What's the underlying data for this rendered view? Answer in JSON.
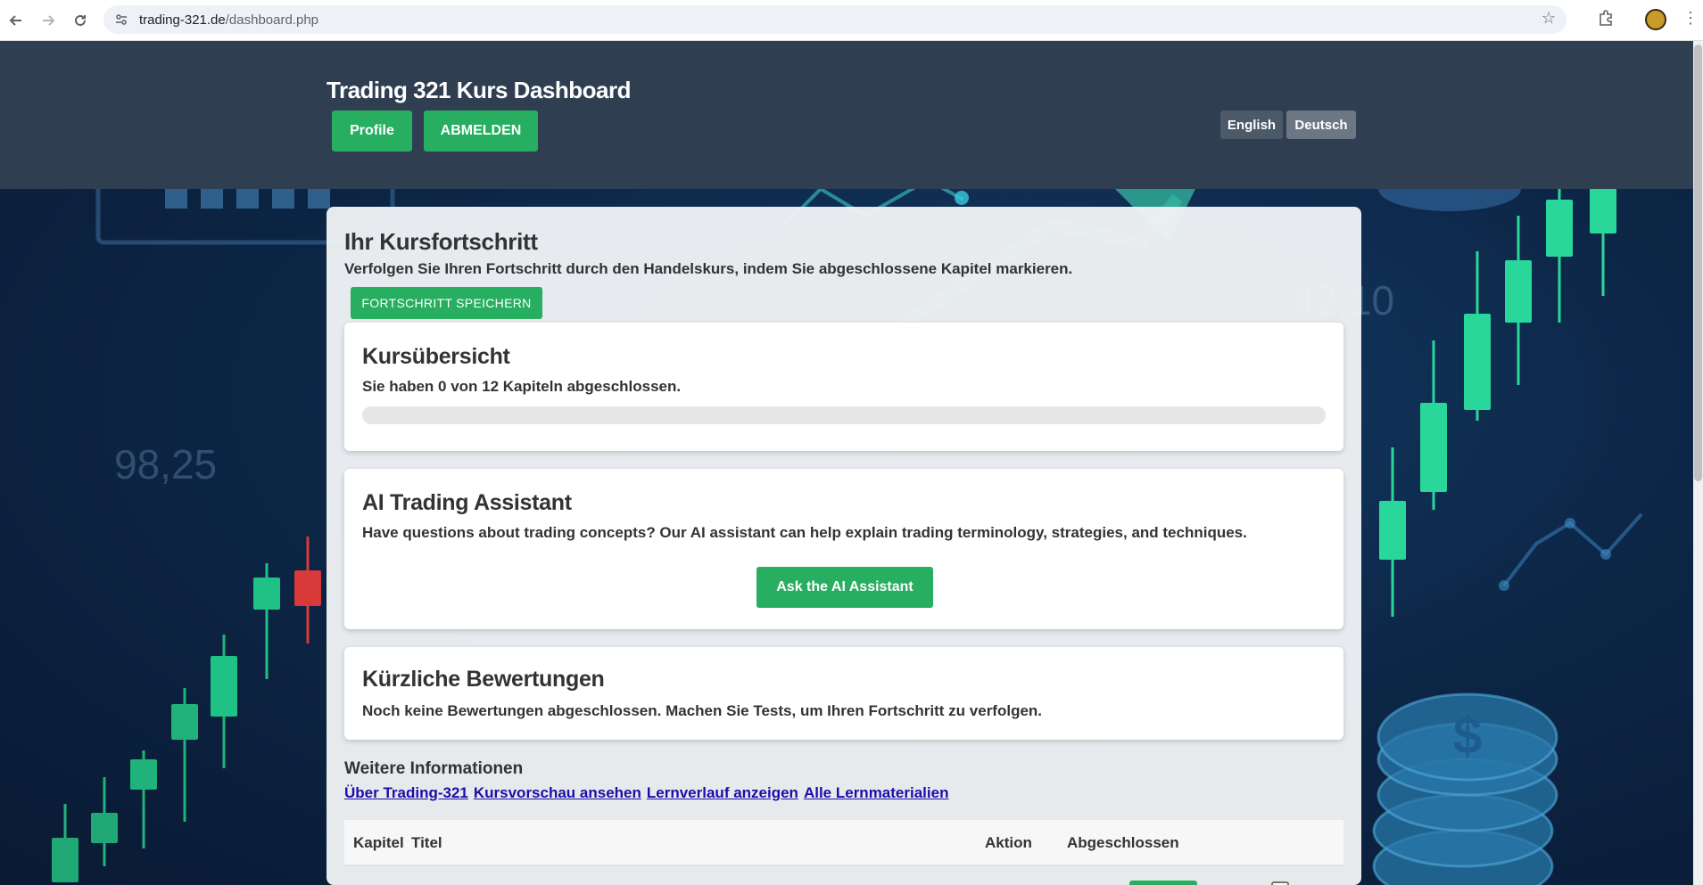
{
  "browser": {
    "url_host": "trading-321.de",
    "url_path": "/dashboard.php",
    "icons": [
      "back-icon",
      "forward-icon",
      "reload-icon",
      "site-info-icon",
      "star-icon",
      "extensions-icon",
      "avatar",
      "menu-icon"
    ]
  },
  "header": {
    "title": "Trading 321 Kurs Dashboard",
    "profile_label": "Profile",
    "logout_label": "ABMELDEN",
    "lang_en": "English",
    "lang_de": "Deutsch"
  },
  "background": {
    "number_left": "98,25",
    "number_right": "42,10"
  },
  "progress_section": {
    "title": "Ihr Kursfortschritt",
    "description": "Verfolgen Sie Ihren Fortschritt durch den Handelskurs, indem Sie abgeschlossene Kapitel markieren.",
    "save_label": "FORTSCHRITT SPEICHERN"
  },
  "overview": {
    "title": "Kursübersicht",
    "summary": "Sie haben 0 von 12 Kapiteln abgeschlossen.",
    "completed": 0,
    "total": 12
  },
  "ai": {
    "title": "AI Trading Assistant",
    "description": "Have questions about trading concepts? Our AI assistant can help explain trading terminology, strategies, and techniques.",
    "button_label": "Ask the AI Assistant"
  },
  "assessments": {
    "title": "Kürzliche Bewertungen",
    "description": "Noch keine Bewertungen abgeschlossen. Machen Sie Tests, um Ihren Fortschritt zu verfolgen."
  },
  "more_info": {
    "title": "Weitere Informationen",
    "links": [
      "Über Trading-321",
      "Kursvorschau ansehen",
      "Lernverlauf anzeigen",
      "Alle Lernmaterialien"
    ]
  },
  "table": {
    "headers": [
      "Kapitel",
      "Titel",
      "Aktion",
      "Abgeschlossen"
    ]
  },
  "colors": {
    "accent_green": "#27ae60",
    "header_bg": "#2f3e50",
    "link": "#1a0dab"
  }
}
